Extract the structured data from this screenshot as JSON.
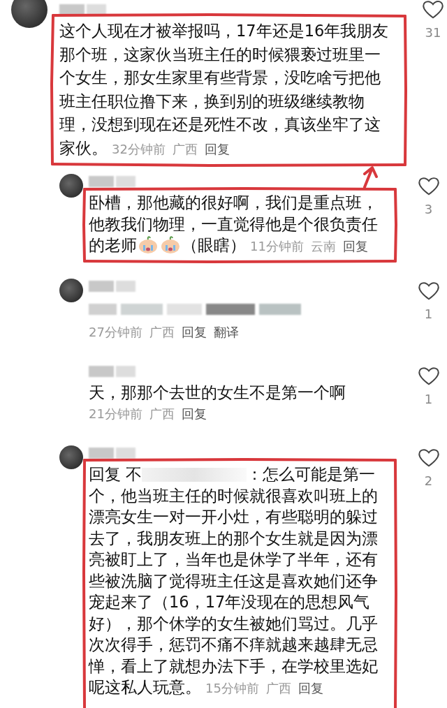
{
  "comments": [
    {
      "has_avatar": true,
      "segments": [
        {
          "kind": "text",
          "text": "这个人现在才被举报吗，17年还是16年我朋友那个班，这家伙当班主任的时候猥亵过班里一个女生，那女生家里有些背景，没吃啥亏把他班主任职位撸下来，换到别的班级继续教物理，没想到现在还是死性不改，真该坐牢了这家伙。"
        }
      ],
      "meta_inline": true,
      "time": "32分钟前",
      "location": "广西",
      "actions": [
        "回复"
      ],
      "likes": "31",
      "replies": [
        {
          "has_avatar": true,
          "segments": [
            {
              "kind": "text",
              "text": "卧槽，那他藏的很好啊，我们是重点班，他教我们物理，一直觉得他是个很负责任的老师"
            },
            {
              "kind": "emoji"
            },
            {
              "kind": "emoji"
            },
            {
              "kind": "text",
              "text": "（眼瞎）"
            }
          ],
          "meta_inline": true,
          "time": "11分钟前",
          "location": "云南",
          "actions": [
            "回复"
          ],
          "likes": "3"
        },
        {
          "has_avatar": true,
          "segments": [
            {
              "kind": "redacted"
            }
          ],
          "meta_inline": false,
          "time": "27分钟前",
          "location": "广西",
          "actions": [
            "回复",
            "翻译"
          ],
          "likes": "1"
        },
        {
          "has_avatar": false,
          "segments": [
            {
              "kind": "text",
              "text": "天，那那个去世的女生不是第一个啊"
            }
          ],
          "meta_inline": false,
          "time": "21分钟前",
          "location": "广西",
          "actions": [
            "回复"
          ],
          "likes": "1"
        },
        {
          "has_avatar": true,
          "segments": [
            {
              "kind": "text",
              "text": "回复 不"
            },
            {
              "kind": "redacted"
            },
            {
              "kind": "text",
              "text": "：怎么可能是第一个，他当班主任的时候就很喜欢叫班上的漂亮女生一对一开小灶，有些聪明的躲过去了，我朋友班上的那个女生就是因为漂亮被盯上了，当年也是休学了半年，还有些被洗脑了觉得班主任这是喜欢她们还争宠起来了（16，17年没现在的思想风气好），那个休学的女生被她们骂过。几乎次次得手，惩罚不痛不痒就越来越肆无忌惮，看上了就想办法下手，在学校里选妃呢这私人玩意。"
            }
          ],
          "meta_inline": true,
          "time": "15分钟前",
          "location": "广西",
          "actions": [
            "回复"
          ],
          "likes": "2"
        }
      ]
    }
  ]
}
